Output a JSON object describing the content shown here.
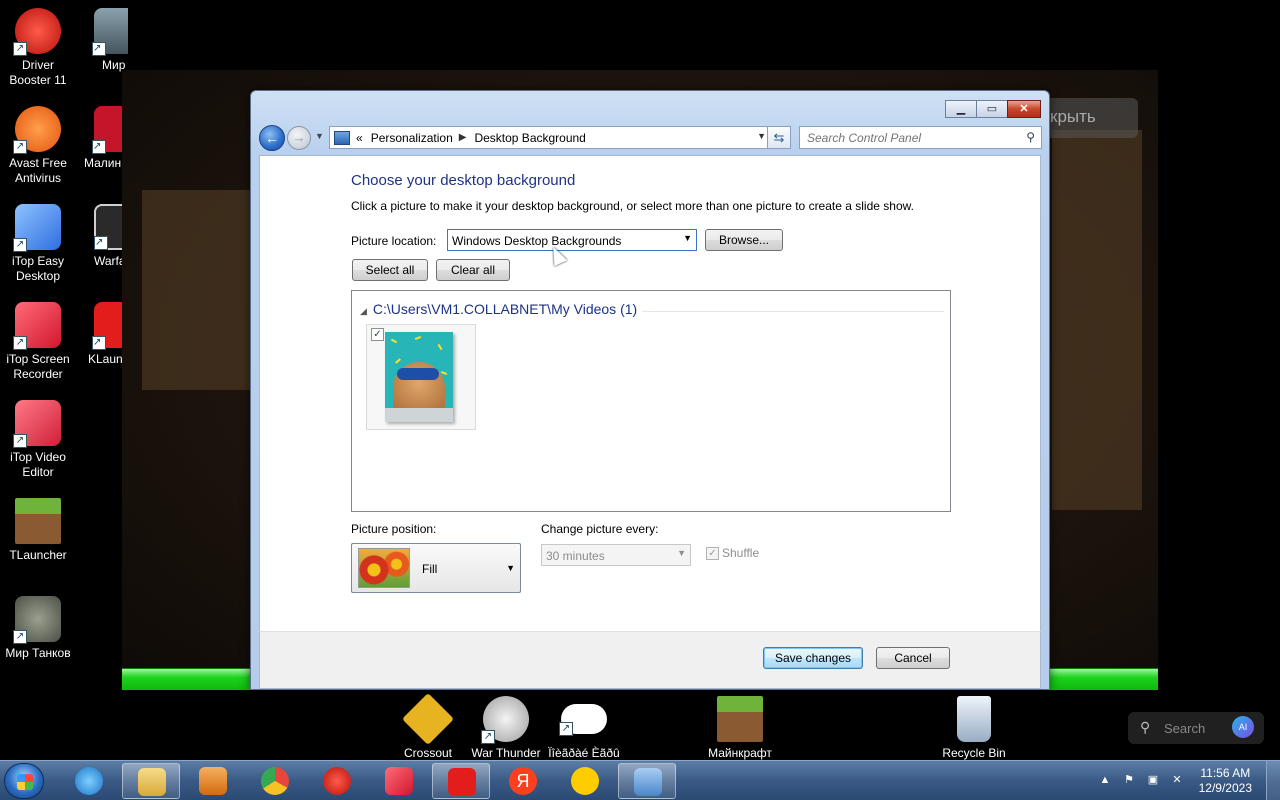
{
  "desktop": {
    "left_icons": [
      {
        "label": "Driver Booster 11",
        "icon": "driver-booster-icon",
        "color": "#d8261f"
      },
      {
        "label": "Avast Free Antivirus",
        "icon": "avast-icon",
        "color": "#f46b1f"
      },
      {
        "label": "iTop Easy Desktop",
        "icon": "itop-easy-desktop-icon",
        "color": "#3a7be0"
      },
      {
        "label": "iTop Screen Recorder",
        "icon": "itop-screen-recorder-icon",
        "color": "#e0253a"
      },
      {
        "label": "iTop Video Editor",
        "icon": "itop-video-editor-icon",
        "color": "#e2283f"
      },
      {
        "label": "TLauncher",
        "icon": "tlauncher-icon",
        "color": "#5a8d2e"
      },
      {
        "label": "Мир Танков",
        "icon": "mir-tankov-icon",
        "color": "#6b6f66"
      }
    ],
    "second_col_icons": [
      {
        "label": "Мир Кораб",
        "icon": "mir-korabley-icon",
        "color": "#6a7c86"
      },
      {
        "label": "Малин",
        "icon": "malinovka-icon",
        "color": "#c4162b"
      },
      {
        "label": "Warfa",
        "icon": "warface-icon",
        "color": "#cfcfcf"
      },
      {
        "label": "KLaun",
        "icon": "klauncher-icon",
        "color": "#e31c1c"
      }
    ],
    "bottom_icons": [
      {
        "label": "Crossout",
        "icon": "crossout-icon",
        "color": "#e7b321"
      },
      {
        "label": "War Thunder",
        "icon": "war-thunder-icon",
        "color": "#d9d9d9"
      },
      {
        "label": "Ïîèãðàé Èãðû",
        "icon": "gamepad-icon",
        "color": "#ffffff"
      },
      {
        "label": "Майнкрафт",
        "icon": "minecraft-icon",
        "color": "#5a8d2e"
      },
      {
        "label": "Recycle Bin",
        "icon": "recycle-bin-icon",
        "color": "#c9d7e6"
      }
    ],
    "bg_app_button": "крыть",
    "search_widget": {
      "placeholder": "Search",
      "ai_label": "AI"
    }
  },
  "dialog": {
    "breadcrumb": [
      "Personalization",
      "Desktop Background"
    ],
    "breadcrumb_prefix": "«",
    "search_placeholder": "Search Control Panel",
    "title": "Choose your desktop background",
    "subtitle": "Click a picture to make it your desktop background, or select more than one picture to create a slide show.",
    "picture_location_label": "Picture location:",
    "picture_location_value": "Windows Desktop Backgrounds",
    "browse_label": "Browse...",
    "select_all_label": "Select all",
    "clear_all_label": "Clear all",
    "group_header": "C:\\Users\\VM1.COLLABNET\\My Videos (1)",
    "thumbnail_checked": true,
    "picture_position_label": "Picture position:",
    "picture_position_value": "Fill",
    "change_every_label": "Change picture every:",
    "change_every_value": "30 minutes",
    "shuffle_label": "Shuffle",
    "shuffle_checked": true,
    "save_label": "Save changes",
    "cancel_label": "Cancel"
  },
  "taskbar": {
    "apps": [
      {
        "name": "internet-explorer",
        "color": "#2a8ee0"
      },
      {
        "name": "file-explorer",
        "color": "#e9c25a",
        "active": true
      },
      {
        "name": "media-player",
        "color": "#e78a2a"
      },
      {
        "name": "chrome",
        "color": "#e8453c"
      },
      {
        "name": "driver-booster",
        "color": "#d8261f"
      },
      {
        "name": "itop-screen-recorder",
        "color": "#e0253a"
      },
      {
        "name": "klauncher",
        "color": "#e31c1c",
        "active": true
      },
      {
        "name": "yandex",
        "color": "#fc3f1d"
      },
      {
        "name": "yandex-music",
        "color": "#ffcc00"
      },
      {
        "name": "control-panel",
        "color": "#6aa3dc",
        "active": true
      }
    ],
    "time": "11:56 AM",
    "date": "12/9/2023"
  }
}
